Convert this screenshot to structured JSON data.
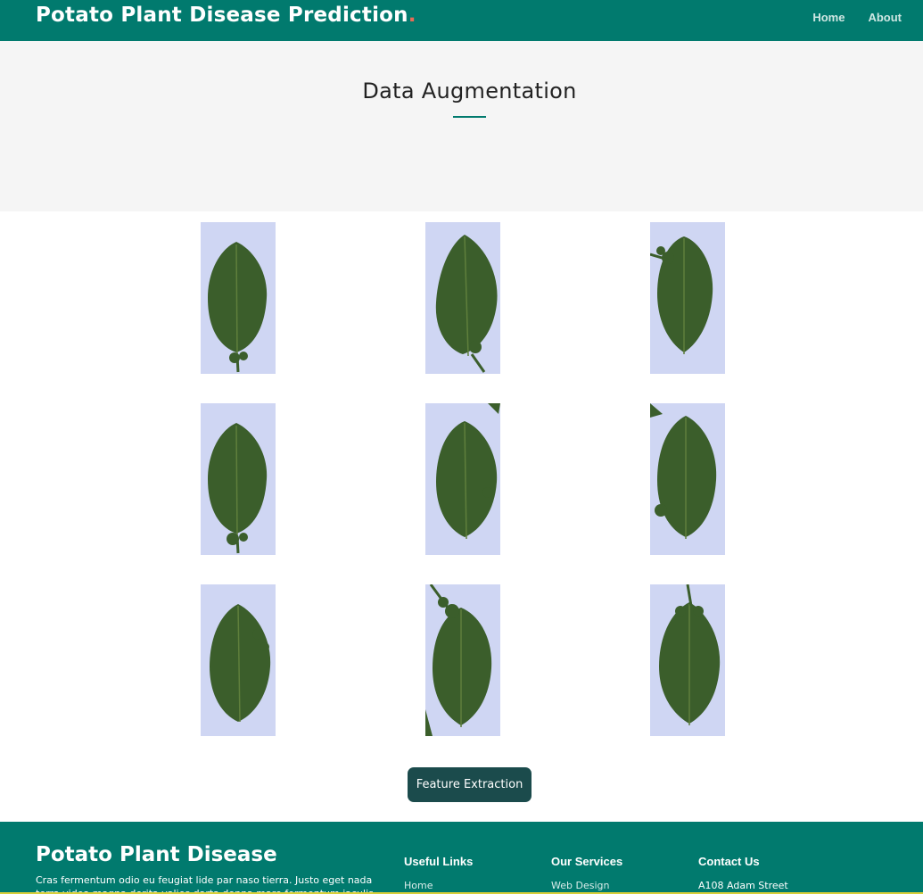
{
  "header": {
    "brand": "Potato Plant Disease Prediction",
    "brand_dot": ".",
    "nav": [
      "Home",
      "About"
    ]
  },
  "hero": {
    "title": "Data Augmentation"
  },
  "gallery": {
    "count": 9
  },
  "actions": {
    "feature_extraction_label": "Feature Extraction"
  },
  "footer": {
    "brand": "Potato Plant Disease",
    "description": "Cras fermentum odio eu feugiat lide par naso tierra. Justo eget nada terra videa magna derita valies darta donna mare fermentum iaculis eu non",
    "useful_links": {
      "heading": "Useful Links",
      "items": [
        "Home"
      ]
    },
    "services": {
      "heading": "Our Services",
      "items": [
        "Web Design"
      ]
    },
    "contact": {
      "heading": "Contact Us",
      "address": "A108 Adam Street"
    }
  },
  "colors": {
    "primary": "#017a6e",
    "accent_dot": "#e96b56",
    "button": "#1b4b4c",
    "hero_bg": "#f5f5f5",
    "leaf_bg": "#cfd6f3",
    "leaf_green": "#3b5e2b"
  }
}
